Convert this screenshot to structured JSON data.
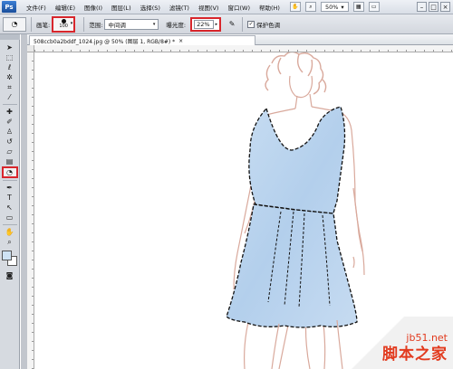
{
  "app": {
    "logo": "Ps",
    "menu": [
      "文件(F)",
      "编辑(E)",
      "图像(I)",
      "图层(L)",
      "选择(S)",
      "滤镜(T)",
      "视图(V)",
      "窗口(W)",
      "帮助(H)"
    ],
    "zoom": "50%",
    "zoom_arrow": "▾"
  },
  "options": {
    "brush_label": "画笔:",
    "brush_size": "100",
    "range_label": "范围:",
    "range_value": "中间调",
    "exposure_label": "曝光度:",
    "exposure_value": "22%",
    "protect_label": "保护色调",
    "protect_checked": true
  },
  "document": {
    "tab_title": "508ccb0a2bddf_1024.jpg @ 50% (图层 1, RGB/8#) *",
    "close": "×"
  },
  "toolbox": {
    "tools": [
      "move-icon",
      "marquee-icon",
      "lasso-icon",
      "magic-wand-icon",
      "crop-icon",
      "eyedropper-icon",
      "healing-icon",
      "brush-icon",
      "stamp-icon",
      "history-brush-icon",
      "eraser-icon",
      "gradient-icon",
      "dodge-icon",
      "pen-icon",
      "type-icon",
      "path-select-icon",
      "shape-icon",
      "hand-icon",
      "zoom-icon"
    ],
    "selected_tool": "dodge-icon",
    "fg_color": "#cfe3f4",
    "bg_color": "#ffffff"
  },
  "colors": {
    "accent_red": "#d8262c",
    "dress_fill": "#b9d4ee",
    "sketch_line": "#d9a99c"
  },
  "watermark": {
    "url": "jb51.net",
    "name": "脚本之家"
  }
}
